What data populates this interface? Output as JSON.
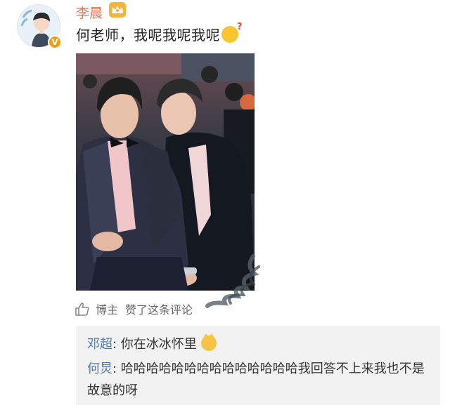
{
  "post": {
    "author": "李晨",
    "text": "何老师，我呢我呢我呢",
    "verified_badge": "V",
    "accent_color": "#eb7350"
  },
  "like_row": {
    "actor": "博主",
    "action": "赞了这条评论"
  },
  "comments": [
    {
      "author": "邓超",
      "separator": ": ",
      "text": "你在冰冰怀里"
    },
    {
      "author": "何炅",
      "separator": ": ",
      "text": "哈哈哈哈哈哈哈哈哈哈哈哈哈哈我回答不上来我也不是故意的呀"
    }
  ],
  "icons": {
    "crown": "crown-icon",
    "thinking": "thinking-emoji-icon",
    "cat": "cat-emoji-icon",
    "like": "thumbs-up-icon"
  }
}
